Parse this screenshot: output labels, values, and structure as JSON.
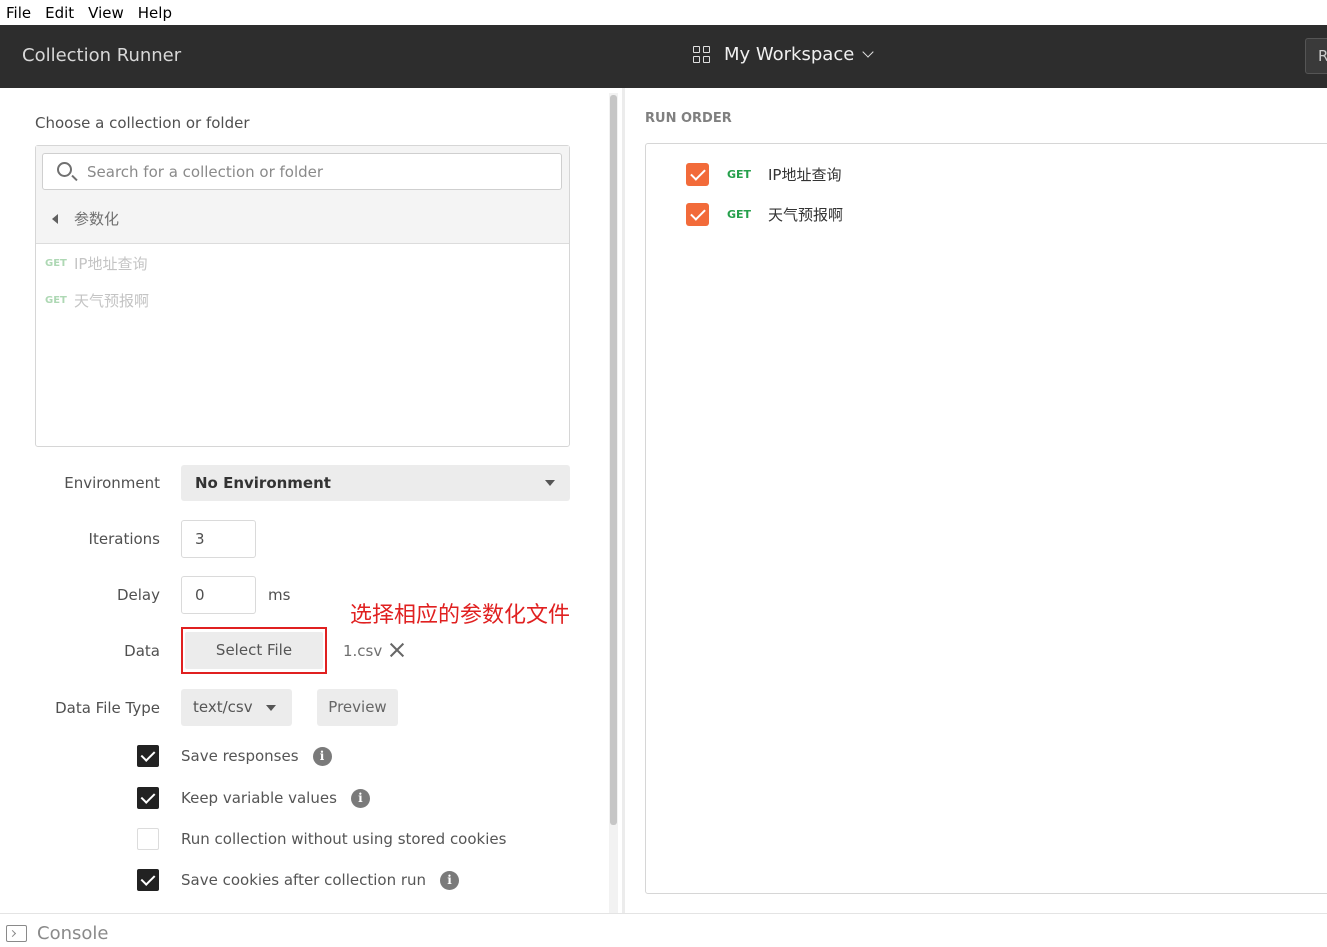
{
  "menu": [
    "File",
    "Edit",
    "View",
    "Help"
  ],
  "header": {
    "app_title": "Collection Runner",
    "workspace": "My Workspace",
    "right_button": "R"
  },
  "left": {
    "choose_label": "Choose a collection or folder",
    "search_placeholder": "Search for a collection or folder",
    "folder_name": "参数化",
    "requests": [
      {
        "method": "GET",
        "name": "IP地址查询"
      },
      {
        "method": "GET",
        "name": "天气预报啊"
      }
    ],
    "environment": {
      "label": "Environment",
      "value": "No Environment"
    },
    "iterations": {
      "label": "Iterations",
      "value": "3"
    },
    "delay": {
      "label": "Delay",
      "value": "0",
      "unit": "ms"
    },
    "data": {
      "label": "Data",
      "button": "Select File",
      "file_name": "1.csv"
    },
    "annotation": "选择相应的参数化文件",
    "data_file_type": {
      "label": "Data File Type",
      "value": "text/csv",
      "preview": "Preview"
    },
    "options": [
      {
        "label": "Save responses",
        "checked": true,
        "info": true
      },
      {
        "label": "Keep variable values",
        "checked": true,
        "info": true
      },
      {
        "label": "Run collection without using stored cookies",
        "checked": false,
        "info": false
      },
      {
        "label": "Save cookies after collection run",
        "checked": true,
        "info": true
      }
    ]
  },
  "right": {
    "run_order_label": "RUN ORDER",
    "items": [
      {
        "method": "GET",
        "name": "IP地址查询",
        "checked": true
      },
      {
        "method": "GET",
        "name": "天气预报啊",
        "checked": true
      }
    ]
  },
  "status": {
    "console": "Console"
  },
  "colors": {
    "accent_orange": "#f26b3a",
    "get_green": "#26a04c",
    "annotation_red": "#e02020",
    "titlebar": "#2d2d2d"
  }
}
